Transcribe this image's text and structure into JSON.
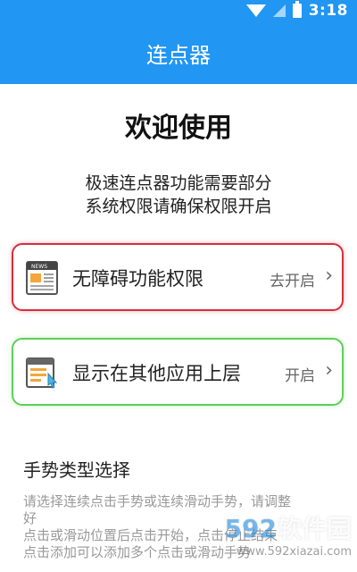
{
  "status_bar": {
    "time": "3:18"
  },
  "app_bar": {
    "title": "连点器"
  },
  "welcome": {
    "title": "欢迎使用",
    "line1": "极速连点器功能需要部分",
    "line2": "系统权限请确保权限开启"
  },
  "permissions": [
    {
      "label": "无障碍功能权限",
      "action": "去开启",
      "border_color": "#d32f3f",
      "icon": "news-icon"
    },
    {
      "label": "显示在其他应用上层",
      "action": "开启",
      "border_color": "#5fce5a",
      "icon": "overlay-window-icon"
    }
  ],
  "gesture": {
    "title": "手势类型选择",
    "hint_lines": [
      "请选择连续点击手势或连续滑动手势，请调整",
      "好",
      "点击或滑动位置后点击开始，点击停止结束",
      "点击添加可以添加多个点击或滑动手势"
    ]
  },
  "watermark": {
    "big_num": "592",
    "big_text": "软件园",
    "url": "www.592xiazai.com"
  },
  "colors": {
    "accent": "#2196f3"
  }
}
